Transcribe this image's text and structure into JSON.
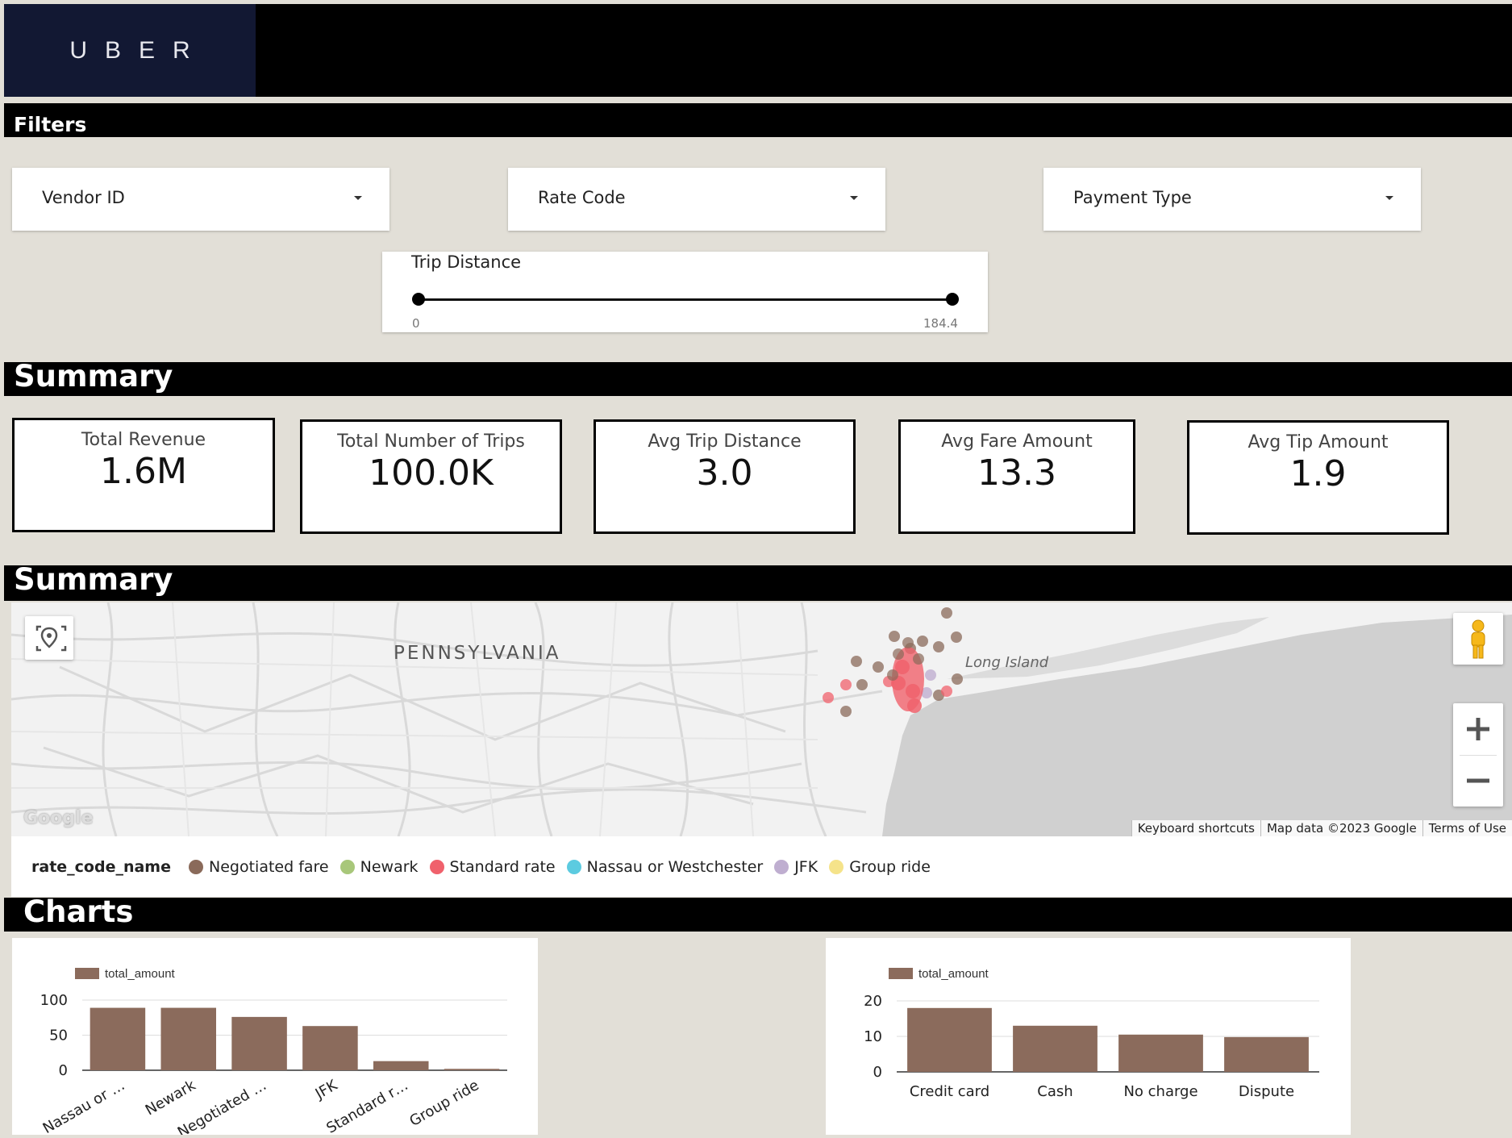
{
  "header": {
    "logo_text": "UBER"
  },
  "sections": {
    "filters": "Filters",
    "summary_kpi": "Summary",
    "summary_map": "Summary",
    "charts": "Charts"
  },
  "filters": {
    "vendor_id": "Vendor ID",
    "rate_code": "Rate Code",
    "payment_type": "Payment Type",
    "trip_distance": {
      "label": "Trip Distance",
      "min": "0",
      "max": "184.4"
    }
  },
  "kpis": [
    {
      "label": "Total Revenue",
      "value": "1.6M"
    },
    {
      "label": "Total Number of Trips",
      "value": "100.0K"
    },
    {
      "label": "Avg Trip Distance",
      "value": "3.0"
    },
    {
      "label": "Avg Fare Amount",
      "value": "13.3"
    },
    {
      "label": "Avg Tip Amount",
      "value": "1.9"
    }
  ],
  "map": {
    "region_label": "PENNSYLVANIA",
    "place_label": "Long Island",
    "google_logo": "Google",
    "attribution": [
      "Keyboard shortcuts",
      "Map data ©2023 Google",
      "Terms of Use"
    ],
    "icons": [
      "geolocate-icon",
      "pegman-icon",
      "zoom-in-icon",
      "zoom-out-icon"
    ]
  },
  "legend": {
    "title": "rate_code_name",
    "items": [
      {
        "label": "Negotiated fare",
        "color": "#8a6a5a"
      },
      {
        "label": "Newark",
        "color": "#a8c77a"
      },
      {
        "label": "Standard rate",
        "color": "#f0616c"
      },
      {
        "label": "Nassau or Westchester",
        "color": "#5ccbe0"
      },
      {
        "label": "JFK",
        "color": "#bfaed0"
      },
      {
        "label": "Group ride",
        "color": "#f5e38a"
      }
    ]
  },
  "colors": {
    "bar": "#8b6b5c",
    "section_bg": "#000000",
    "page_bg": "#e2dfd7"
  },
  "chart_data": [
    {
      "type": "bar",
      "legend": "total_amount",
      "categories": [
        "Nassau or …",
        "Newark",
        "Negotiated …",
        "JFK",
        "Standard r…",
        "Group ride"
      ],
      "values": [
        89,
        89,
        76,
        63,
        13,
        2
      ],
      "ylim": [
        0,
        100
      ],
      "yticks": [
        "0",
        "50",
        "100"
      ],
      "grid": true
    },
    {
      "type": "bar",
      "legend": "total_amount",
      "categories": [
        "Credit card",
        "Cash",
        "No charge",
        "Dispute"
      ],
      "values": [
        18,
        13,
        10.5,
        9.8
      ],
      "ylim": [
        0,
        20
      ],
      "yticks": [
        "0",
        "10",
        "20"
      ],
      "grid": true
    }
  ]
}
